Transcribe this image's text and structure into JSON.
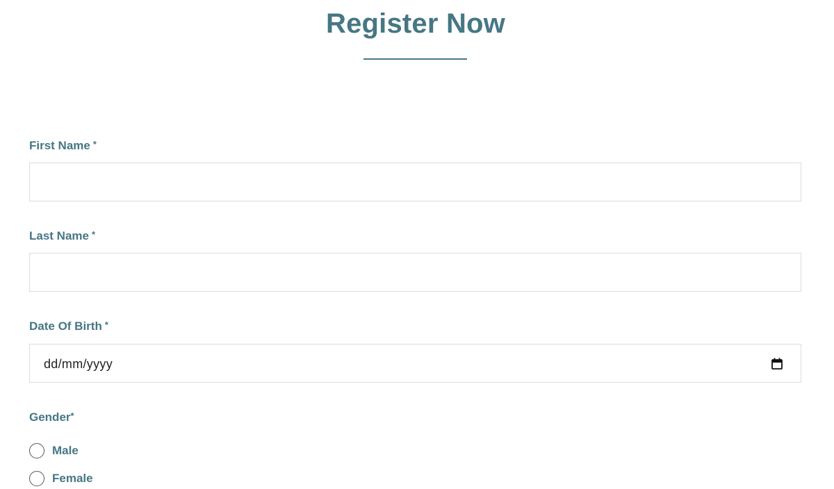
{
  "form": {
    "title": "Register Now",
    "required_marker": "*",
    "first_name": {
      "label": "First Name",
      "value": "",
      "placeholder": ""
    },
    "last_name": {
      "label": "Last Name",
      "value": "",
      "placeholder": ""
    },
    "date_of_birth": {
      "label": "Date Of Birth",
      "placeholder": "dd/mm/yyyy",
      "icon": "calendar-icon"
    },
    "gender": {
      "label": "Gender",
      "options": [
        {
          "label": "Male",
          "selected": false
        },
        {
          "label": "Female",
          "selected": false
        }
      ]
    }
  },
  "colors": {
    "accent": "#467784",
    "input_border": "#dcdcdc",
    "background": "#ffffff"
  }
}
